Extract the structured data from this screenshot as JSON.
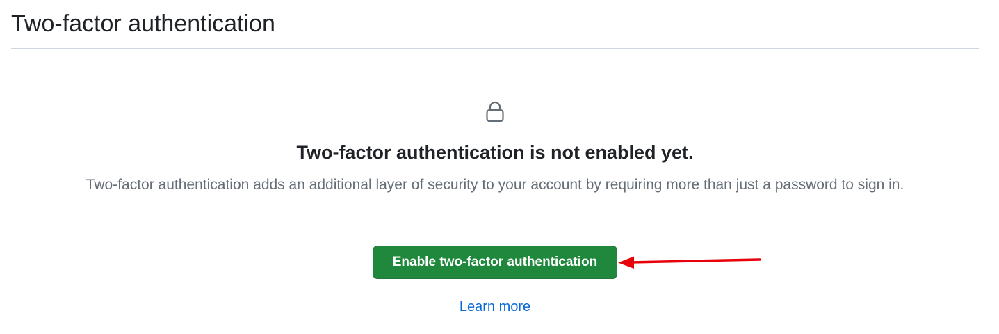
{
  "header": {
    "title": "Two-factor authentication"
  },
  "blankslate": {
    "icon": "lock-icon",
    "heading": "Two-factor authentication is not enabled yet.",
    "description": "Two-factor authentication adds an additional layer of security to your account by requiring more than just a password to sign in.",
    "enable_button_label": "Enable two-factor authentication",
    "learn_more_label": "Learn more"
  },
  "colors": {
    "primary_button": "#1f883d",
    "link": "#0969da",
    "annotation_arrow": "#e8000b",
    "muted_text": "#656d76",
    "divider": "#d0d7de"
  }
}
